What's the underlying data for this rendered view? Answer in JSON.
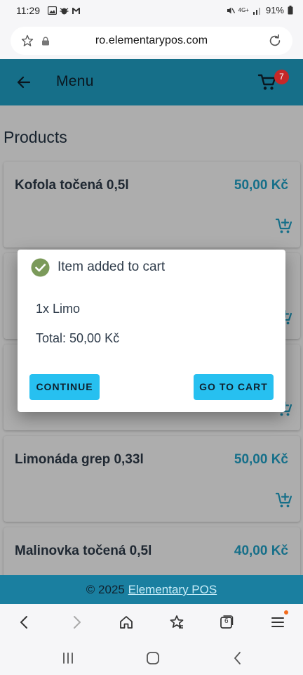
{
  "status_bar": {
    "time": "11:29",
    "network": "4G+",
    "battery": "91%"
  },
  "browser": {
    "url": "ro.elementarypos.com",
    "open_tabs": "6"
  },
  "header": {
    "title": "Menu",
    "cart_count": "7"
  },
  "products": {
    "heading": "Products",
    "items": [
      {
        "name": "Kofola točená 0,5l",
        "price": "50,00 Kč"
      },
      {
        "name": "",
        "price": ""
      },
      {
        "name": "",
        "price": ""
      },
      {
        "name": "Limonáda grep 0,33l",
        "price": "50,00 Kč"
      },
      {
        "name": "Malinovka točená 0,5l",
        "price": "40,00 Kč"
      }
    ]
  },
  "dialog": {
    "title": "Item added to cart",
    "item_line": "1x Limo",
    "total_label": "Total: 50,00 Kč",
    "continue_label": "CONTINUE",
    "go_to_cart_label": "GO TO CART"
  },
  "footer": {
    "copyright": "© 2025 ",
    "link_text": "Elementary POS"
  },
  "colors": {
    "primary": "#21a4cb",
    "footer": "#1a7fa0",
    "button": "#27c0f0",
    "badge": "#c62828",
    "success": "#7b9a5a"
  }
}
